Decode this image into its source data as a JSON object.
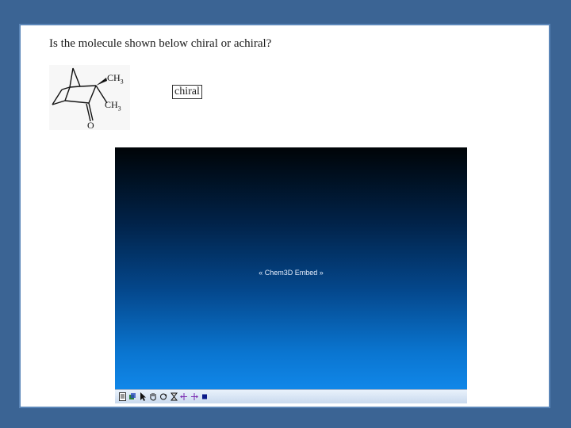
{
  "question": {
    "text": "Is the molecule shown below chiral or achiral?"
  },
  "molecule": {
    "label_top": "CH",
    "label_top_sub": "3",
    "label_mid": "CH",
    "label_mid_sub": "3",
    "label_bottom": "O"
  },
  "answer": {
    "text": "chiral"
  },
  "embed": {
    "label": "« Chem3D Embed »",
    "toolbar_icons": [
      "document-icon",
      "cube-icon",
      "select-arrow-icon",
      "hand-icon",
      "rotate-icon",
      "hourglass-icon",
      "translate-icon",
      "zoom-icon",
      "stop-icon"
    ]
  },
  "colors": {
    "background": "#3b6494",
    "slide_border": "#5b86b8",
    "embed_top": "#000407",
    "embed_bottom": "#138ef2"
  }
}
